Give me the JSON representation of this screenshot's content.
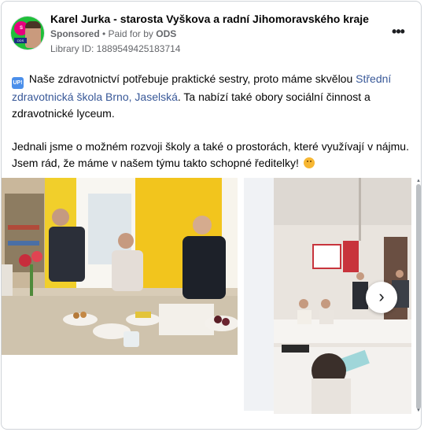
{
  "header": {
    "page_name": "Karel Jurka - starosta Vyškova a radní Jihomoravského kraje",
    "sponsored": "Sponsored",
    "separator": " • ",
    "paid_for_prefix": "Paid for by ",
    "payer": "ODS",
    "library_id": "Library ID: 1889549425183714",
    "avatar_badge": "S",
    "avatar_tag": "ODS",
    "more_label": "•••"
  },
  "post": {
    "up_icon": "UP!",
    "p1_before": " Naše zdravotnictví potřebuje praktické sestry, proto máme skvělou ",
    "p1_link": "Střední zdravotnická škola Brno, Jaselská",
    "p1_after": ". Ta nabízí také obory sociální činnost a zdravotnické lyceum.",
    "p2": "Jednali jsme o možném rozvoji školy a také o prostorách, které využívají v nájmu. Jsem rád, že máme v našem týmu takto schopné ředitelky! "
  },
  "carousel": {
    "next_icon": "›",
    "scroll_up": "▲",
    "scroll_down": "▼"
  },
  "icons": {
    "up": "up-icon",
    "smile": "smile-icon",
    "next": "chevron-right-icon",
    "more": "more-icon"
  },
  "colors": {
    "link": "#385898",
    "meta": "#65676b",
    "avatar_bg": "#1fbf3a",
    "avatar_badge": "#e6007e"
  }
}
